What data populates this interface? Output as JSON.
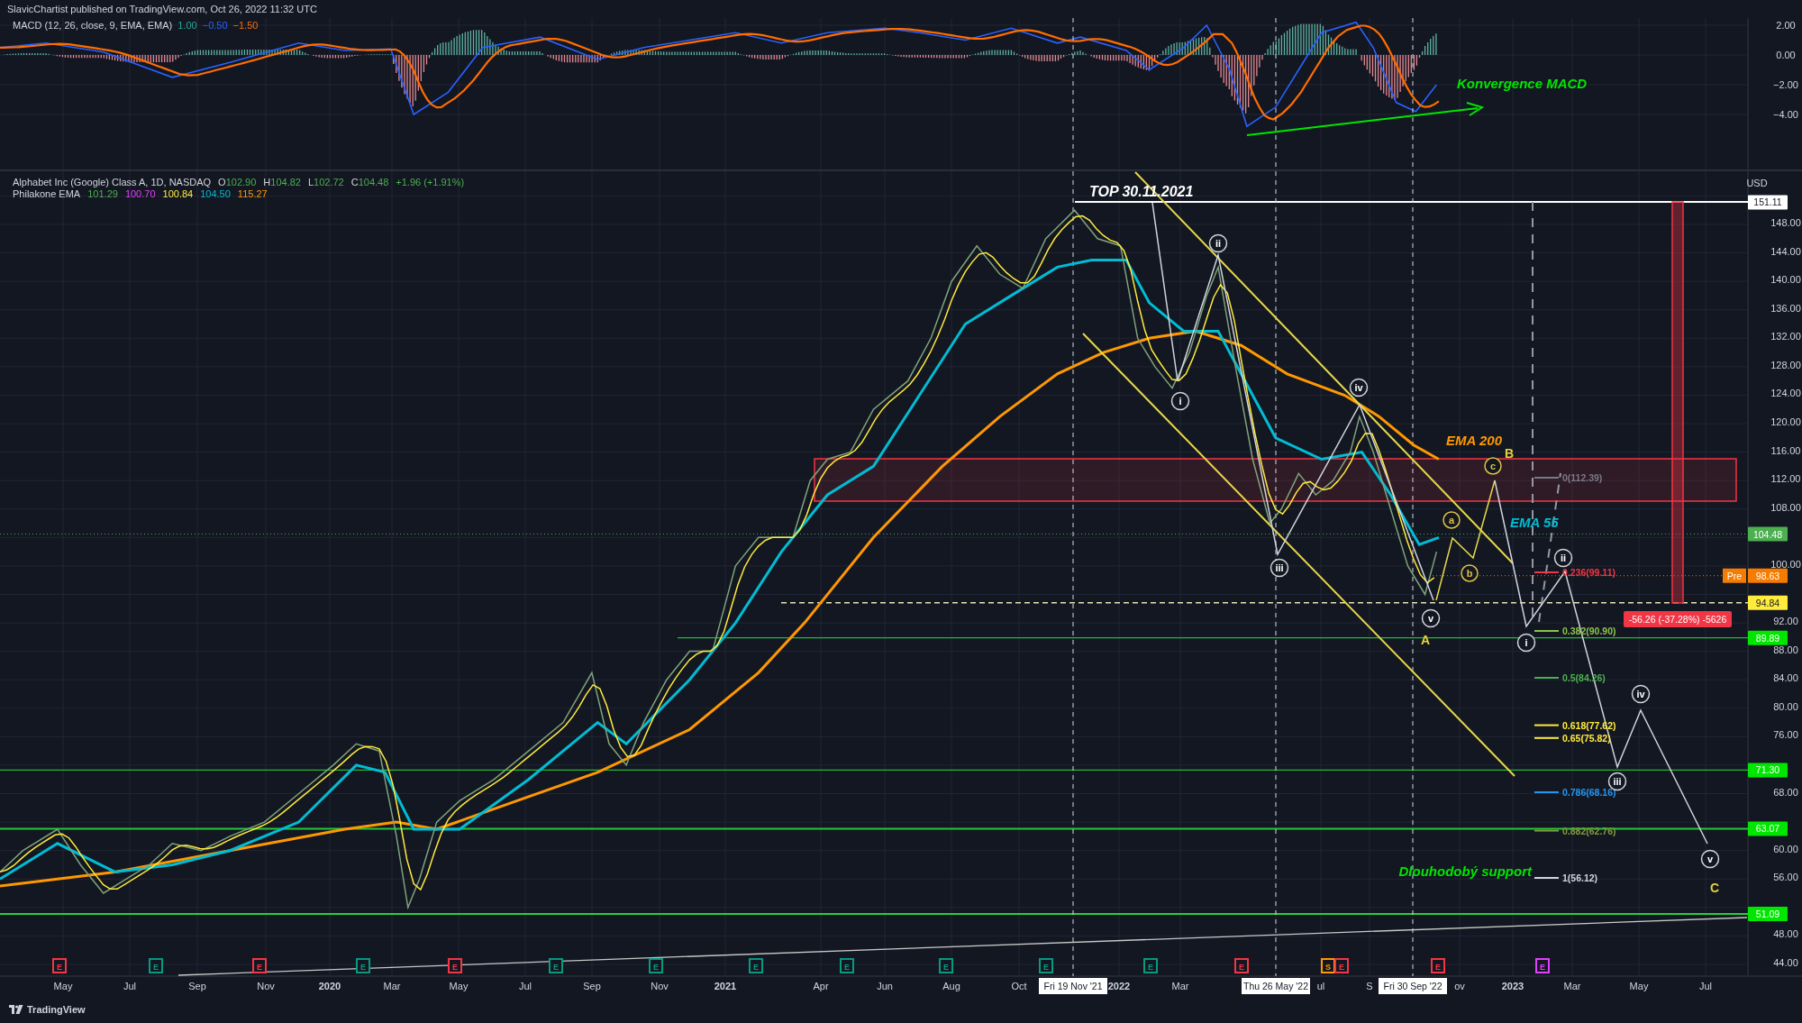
{
  "header": {
    "text": "SlavicChartist published on TradingView.com, Oct 26, 2022 11:32 UTC"
  },
  "macd": {
    "title": "MACD (12, 26, close, 9, EMA, EMA)",
    "values": [
      {
        "text": "1.00",
        "color": "#26a69a"
      },
      {
        "text": "−0.50",
        "color": "#2962ff"
      },
      {
        "text": "−1.50",
        "color": "#ff6d00"
      }
    ],
    "axis": [
      "2.00",
      "0.00",
      "−2.00",
      "−4.00"
    ],
    "note": "Konvergence MACD"
  },
  "legend": {
    "symbol": "Alphabet Inc (Google) Class A, 1D, NASDAQ",
    "ohlc": [
      {
        "key": "O",
        "value": "102.90"
      },
      {
        "key": "H",
        "value": "104.82"
      },
      {
        "key": "L",
        "value": "102.72"
      },
      {
        "key": "C",
        "value": "104.48"
      }
    ],
    "change": "+1.96 (+1.91%)",
    "indicator": "Philakone EMA",
    "indicator_values": [
      {
        "text": "101.29",
        "color": "#4caf50"
      },
      {
        "text": "100.70",
        "color": "#e040fb"
      },
      {
        "text": "100.84",
        "color": "#ffeb3b"
      },
      {
        "text": "104.50",
        "color": "#00bcd4"
      },
      {
        "text": "115.27",
        "color": "#ff9800"
      }
    ]
  },
  "price_axis": {
    "unit": "USD",
    "ticks": [
      "148.00",
      "144.00",
      "140.00",
      "136.00",
      "132.00",
      "128.00",
      "124.00",
      "120.00",
      "116.00",
      "112.00",
      "108.00",
      "100.00",
      "92.00",
      "88.00",
      "84.00",
      "80.00",
      "76.00",
      "68.00",
      "60.00",
      "56.00",
      "48.00",
      "44.00"
    ],
    "badges": [
      {
        "text": "151.11",
        "color": "#ffffff"
      },
      {
        "text": "104.48",
        "color": "#4caf50"
      },
      {
        "prefix": "Pre",
        "text": "98.63",
        "color": "#f57c00"
      },
      {
        "text": "94.84",
        "color": "#ffeb3b"
      },
      {
        "text": "89.89",
        "color": "#00e600"
      },
      {
        "text": "71.30",
        "color": "#00e600"
      },
      {
        "text": "63.07",
        "color": "#00e600"
      },
      {
        "text": "51.09",
        "color": "#00e600"
      }
    ]
  },
  "annotations": {
    "top": "TOP 30.11.2021",
    "ema200": "EMA 200",
    "ema55": "EMA 55",
    "support": "Dlouhodobý support",
    "measure": "-56.26 (-37.28%) -5626"
  },
  "waves": [
    {
      "label": "i",
      "kind": "roman"
    },
    {
      "label": "ii",
      "kind": "roman"
    },
    {
      "label": "iii",
      "kind": "roman"
    },
    {
      "label": "iv",
      "kind": "roman"
    },
    {
      "label": "v",
      "kind": "roman"
    },
    {
      "label": "a",
      "kind": "minor"
    },
    {
      "label": "b",
      "kind": "minor"
    },
    {
      "label": "c",
      "kind": "minor"
    },
    {
      "label": "A",
      "kind": "major"
    },
    {
      "label": "B",
      "kind": "major"
    },
    {
      "label": "i",
      "kind": "roman"
    },
    {
      "label": "ii",
      "kind": "roman"
    },
    {
      "label": "iii",
      "kind": "roman"
    },
    {
      "label": "iv",
      "kind": "roman"
    },
    {
      "label": "v",
      "kind": "roman"
    },
    {
      "label": "C",
      "kind": "major"
    }
  ],
  "fib_levels": [
    {
      "label": "0(112.39)",
      "color": "#787b86"
    },
    {
      "label": "0.236(99.11)",
      "color": "#f23645"
    },
    {
      "label": "0.382(90.90)",
      "color": "#8bc34a"
    },
    {
      "label": "0.5(84.26)",
      "color": "#4caf50"
    },
    {
      "label": "0.618(77.62)",
      "color": "#ffeb3b"
    },
    {
      "label": "0.65(75.82)",
      "color": "#ffeb3b"
    },
    {
      "label": "0.786(68.16)",
      "color": "#2196f3"
    },
    {
      "label": "0.882(62.76)",
      "color": "#7f9a3a"
    },
    {
      "label": "1(56.12)",
      "color": "#d1d4dc"
    }
  ],
  "events": [
    {
      "letter": "E",
      "color": "#f23645"
    },
    {
      "letter": "E",
      "color": "#089981"
    },
    {
      "letter": "E",
      "color": "#f23645"
    },
    {
      "letter": "E",
      "color": "#089981"
    },
    {
      "letter": "E",
      "color": "#f23645"
    },
    {
      "letter": "E",
      "color": "#089981"
    },
    {
      "letter": "E",
      "color": "#089981"
    },
    {
      "letter": "E",
      "color": "#089981"
    },
    {
      "letter": "E",
      "color": "#089981"
    },
    {
      "letter": "E",
      "color": "#089981"
    },
    {
      "letter": "E",
      "color": "#089981"
    },
    {
      "letter": "E",
      "color": "#089981"
    },
    {
      "letter": "E",
      "color": "#f23645"
    },
    {
      "letter": "S",
      "color": "#ff9800"
    },
    {
      "letter": "E",
      "color": "#f23645"
    },
    {
      "letter": "E",
      "color": "#f23645"
    },
    {
      "letter": "E",
      "color": "#e040fb"
    }
  ],
  "time_axis": [
    {
      "text": "May",
      "kind": "month"
    },
    {
      "text": "Jul",
      "kind": "month"
    },
    {
      "text": "Sep",
      "kind": "month"
    },
    {
      "text": "Nov",
      "kind": "month"
    },
    {
      "text": "2020",
      "kind": "year"
    },
    {
      "text": "Mar",
      "kind": "month"
    },
    {
      "text": "May",
      "kind": "month"
    },
    {
      "text": "Jul",
      "kind": "month"
    },
    {
      "text": "Sep",
      "kind": "month"
    },
    {
      "text": "Nov",
      "kind": "month"
    },
    {
      "text": "2021",
      "kind": "year"
    },
    {
      "text": "Apr",
      "kind": "month"
    },
    {
      "text": "Jun",
      "kind": "month"
    },
    {
      "text": "Aug",
      "kind": "month"
    },
    {
      "text": "Oct",
      "kind": "month"
    },
    {
      "text": "Fri 19 Nov '21",
      "kind": "date"
    },
    {
      "text": "2022",
      "kind": "year"
    },
    {
      "text": "Mar",
      "kind": "month"
    },
    {
      "text": "Thu 26 May '22",
      "kind": "date"
    },
    {
      "text": "ul",
      "kind": "month"
    },
    {
      "text": "S",
      "kind": "month"
    },
    {
      "text": "Fri 30 Sep '22",
      "kind": "date"
    },
    {
      "text": "ov",
      "kind": "month"
    },
    {
      "text": "2023",
      "kind": "year"
    },
    {
      "text": "Mar",
      "kind": "month"
    },
    {
      "text": "May",
      "kind": "month"
    },
    {
      "text": "Jul",
      "kind": "month"
    }
  ],
  "footer": {
    "brand": "TradingView"
  }
}
